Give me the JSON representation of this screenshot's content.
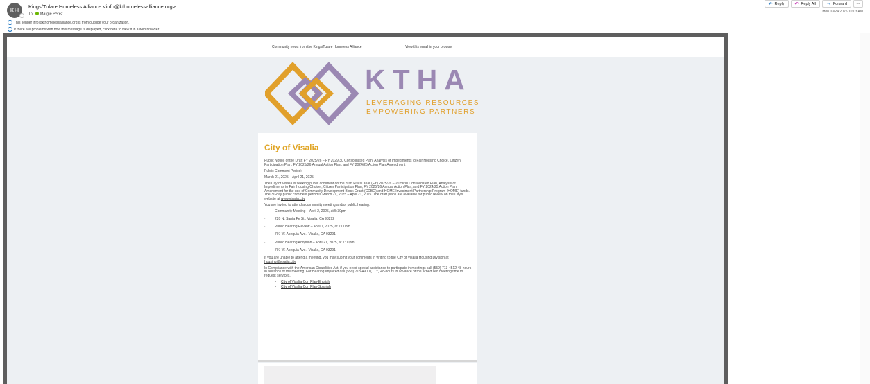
{
  "header": {
    "avatar_initials": "KH",
    "sender": "Kings/Tulare Homeless Alliance <info@kthomelessalliance.org>",
    "to_label": "To",
    "recipient": "Margie Perez",
    "external_notice": "This sender info@kthomelessalliance.org is from outside your organization.",
    "display_notice": "If there are problems with how this message is displayed, click here to view it in a web browser.",
    "timestamp": "Mon 03/24/2025 10:03 AM"
  },
  "actions": {
    "reply": "Reply",
    "reply_all": "Reply All",
    "forward": "Forward",
    "more": "···"
  },
  "email": {
    "preheader": "Community news from the Kings/Tulare Homeless Alliance",
    "view_in_browser": "View this email in your browser",
    "logo": {
      "letters": "KTHA",
      "tagline_1": "LEVERAGING RESOURCES",
      "tagline_2": "EMPOWERING PARTNERS"
    },
    "title": "City of Visalia",
    "intro": "Public Notice of the Draft FY 2025/26 – FY 2029/30 Consolidated Plan, Analysis of Impediments to Fair Housing Choice, Citizen Participation Plan, FY 2025/26 Annual Action Plan, and FY 2024/25 Action Plan Amendment",
    "comment_period_label": "Public Comment Period:",
    "comment_period": "March 21, 2025 – April 21, 2025",
    "body": "The City of Visalia is seeking public comment on the draft Fiscal Year (FY) 2025/26 – 2029/30 Consolidated Plan, Analysis of Impediments to Fair Housing Choice , Citizen Participation Plan, FY 2025/26 Annual Action Plan, and FY 2024/25 Action Plan Amendment for the use of Community Development Block Grant (CDBG) and HOME Investment Partnership Program (HOME) funds. The 30-day public comment period is March 21, 2025 – April 21, 2025. The draft plans are available for public review on the City's website at",
    "website": "www.visalia.city",
    "invite": "You are invited to attend a community meeting and/or public hearing:",
    "meetings": [
      "Community Meeting – April 2, 2025, at 5:30pm",
      "220 N. Santa Fe St., Visalia, CA 93292",
      "Public Hearing Review – April 7, 2025, at 7:00pm",
      "707 W. Acequia Ave., Visalia, CA 93291",
      "Public Hearing Adoption – April 21, 2025, at 7:00pm",
      "707 W. Acequia Ave., Visalia, CA 93291"
    ],
    "unable_text": "If you are unable to attend a meeting, you may submit your comments in writing to the City of Visalia Housing Division at",
    "housing_email": "housing@visalia.city",
    "ada_text": "In Compliance with the American Disabilities Act, if you need special assistance to participate in meetings call (559) 713-4512 48-hours in advance of the meeting.  For Hearing Impaired call (559) 713-4900 (TTY) 48-hours in advance of the scheduled meeting time to request services.",
    "links": [
      "City of Visalia Con Plan-English",
      "City of Visalia Con Plan-Spanish"
    ]
  }
}
